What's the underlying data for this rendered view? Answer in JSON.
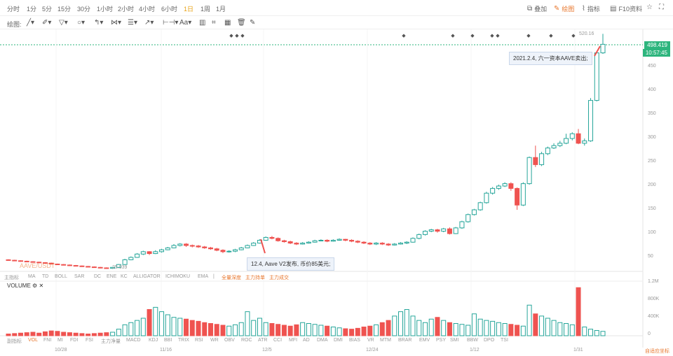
{
  "timeframes": [
    "分时",
    "1分",
    "5分",
    "15分",
    "30分",
    "1小时",
    "2小时",
    "4小时",
    "6小时",
    "1日",
    "1周",
    "1月"
  ],
  "active_timeframe": "1日",
  "top_right": {
    "overlay": "叠加",
    "draw": "绘图",
    "indicator": "指标",
    "f10": "F10资料"
  },
  "draw_label": "绘图:",
  "annotations": {
    "top": "2021.2.4, 六一资本AAVE卖出;",
    "bottom": "12.4, Aave V2发布, 币价85美元;"
  },
  "price_tags": {
    "peak": "520.16",
    "last": "498.419",
    "time": "10:57:45",
    "low": "25.939"
  },
  "watermark": "AAVE/USDT",
  "y_axis_labels": [
    "450",
    "400",
    "350",
    "300",
    "250",
    "200",
    "150",
    "100",
    "50"
  ],
  "main_indicators": [
    "主指标",
    "MA",
    "TD",
    "BOLL",
    "SAR",
    "DC",
    "ENE",
    "KC",
    "ALLIGATOR",
    "ICHIMOKU",
    "EMA",
    "|",
    "全量深度",
    "主力持单",
    "主力成交"
  ],
  "volume_label": "VOLUME",
  "volume_axis": [
    "1.2M",
    "800K",
    "400K",
    "0"
  ],
  "sub_indicators": [
    "副指标",
    "VOL",
    "FNI",
    "MI",
    "FDI",
    "FSI",
    "主力净量",
    "MACD",
    "KDJ",
    "BBI",
    "TRIX",
    "RSI",
    "WR",
    "OBV",
    "ROC",
    "ATR",
    "CCI",
    "MFI",
    "AD",
    "DMA",
    "DMI",
    "BIAS",
    "VR",
    "MTM",
    "BRAR",
    "EMV",
    "PSY",
    "SMI",
    "BBW",
    "DPO",
    "TSI"
  ],
  "x_axis_labels": [
    "10/28",
    "11/16",
    "12/5",
    "12/24",
    "1/12",
    "1/31"
  ],
  "corner_label": "自适应坐标",
  "colors": {
    "up": "#26a69a",
    "down": "#ef5350",
    "accent": "#e8772e",
    "active": "#e8a317",
    "last_price": "#2db57d"
  },
  "chart_data": {
    "type": "candlestick",
    "x_range": [
      "2020-10-20",
      "2021-02-05"
    ],
    "y_range": [
      25,
      520
    ],
    "candles": [
      [
        45,
        44,
        46,
        43
      ],
      [
        44,
        43,
        45,
        42
      ],
      [
        43,
        42,
        44,
        41
      ],
      [
        42,
        41,
        43,
        40
      ],
      [
        41,
        40,
        42,
        39
      ],
      [
        40,
        39,
        41,
        38
      ],
      [
        39,
        38,
        40,
        37
      ],
      [
        38,
        36,
        39,
        35
      ],
      [
        36,
        35,
        37,
        34
      ],
      [
        35,
        34,
        36,
        33
      ],
      [
        34,
        33,
        35,
        32
      ],
      [
        33,
        32,
        34,
        31
      ],
      [
        32,
        31,
        33,
        30
      ],
      [
        31,
        30,
        32,
        29
      ],
      [
        30,
        29,
        31,
        28
      ],
      [
        29,
        28,
        30,
        27
      ],
      [
        28,
        27,
        29,
        26
      ],
      [
        27,
        29,
        30,
        26
      ],
      [
        29,
        35,
        36,
        28
      ],
      [
        35,
        45,
        47,
        34
      ],
      [
        45,
        50,
        52,
        44
      ],
      [
        50,
        57,
        59,
        49
      ],
      [
        57,
        62,
        64,
        55
      ],
      [
        62,
        58,
        63,
        55
      ],
      [
        58,
        62,
        65,
        57
      ],
      [
        62,
        66,
        68,
        60
      ],
      [
        66,
        70,
        72,
        65
      ],
      [
        70,
        75,
        78,
        69
      ],
      [
        75,
        78,
        80,
        73
      ],
      [
        78,
        75,
        80,
        72
      ],
      [
        75,
        74,
        77,
        71
      ],
      [
        74,
        72,
        76,
        70
      ],
      [
        72,
        70,
        74,
        68
      ],
      [
        70,
        68,
        72,
        66
      ],
      [
        68,
        65,
        70,
        63
      ],
      [
        65,
        62,
        67,
        59
      ],
      [
        62,
        63,
        65,
        60
      ],
      [
        63,
        66,
        68,
        61
      ],
      [
        66,
        70,
        72,
        65
      ],
      [
        70,
        75,
        77,
        69
      ],
      [
        75,
        80,
        82,
        74
      ],
      [
        80,
        86,
        88,
        79
      ],
      [
        86,
        92,
        94,
        85
      ],
      [
        92,
        90,
        95,
        88
      ],
      [
        90,
        85,
        92,
        83
      ],
      [
        85,
        83,
        87,
        81
      ],
      [
        83,
        80,
        85,
        78
      ],
      [
        80,
        78,
        82,
        76
      ],
      [
        78,
        80,
        82,
        77
      ],
      [
        80,
        82,
        84,
        79
      ],
      [
        82,
        85,
        87,
        81
      ],
      [
        85,
        86,
        88,
        84
      ],
      [
        86,
        84,
        88,
        82
      ],
      [
        84,
        86,
        88,
        83
      ],
      [
        86,
        88,
        90,
        85
      ],
      [
        88,
        86,
        89,
        84
      ],
      [
        86,
        84,
        88,
        82
      ],
      [
        84,
        82,
        86,
        80
      ],
      [
        82,
        80,
        84,
        78
      ],
      [
        80,
        78,
        82,
        76
      ],
      [
        78,
        80,
        82,
        76
      ],
      [
        80,
        78,
        82,
        76
      ],
      [
        78,
        76,
        80,
        74
      ],
      [
        76,
        78,
        80,
        75
      ],
      [
        78,
        80,
        82,
        77
      ],
      [
        80,
        82,
        84,
        78
      ],
      [
        82,
        90,
        92,
        81
      ],
      [
        90,
        98,
        100,
        88
      ],
      [
        98,
        105,
        107,
        96
      ],
      [
        105,
        108,
        110,
        103
      ],
      [
        108,
        105,
        110,
        102
      ],
      [
        105,
        110,
        112,
        103
      ],
      [
        110,
        100,
        113,
        98
      ],
      [
        100,
        112,
        114,
        99
      ],
      [
        112,
        125,
        127,
        110
      ],
      [
        125,
        140,
        142,
        123
      ],
      [
        140,
        150,
        152,
        138
      ],
      [
        150,
        165,
        167,
        148
      ],
      [
        165,
        185,
        188,
        163
      ],
      [
        185,
        195,
        198,
        182
      ],
      [
        195,
        200,
        203,
        192
      ],
      [
        200,
        205,
        208,
        198
      ],
      [
        205,
        195,
        208,
        190
      ],
      [
        195,
        160,
        197,
        150
      ],
      [
        160,
        205,
        208,
        158
      ],
      [
        205,
        260,
        262,
        203
      ],
      [
        260,
        245,
        285,
        240
      ],
      [
        245,
        268,
        272,
        242
      ],
      [
        268,
        280,
        283,
        265
      ],
      [
        280,
        285,
        290,
        278
      ],
      [
        285,
        290,
        295,
        282
      ],
      [
        290,
        300,
        310,
        288
      ],
      [
        300,
        310,
        313,
        296
      ],
      [
        310,
        290,
        320,
        288
      ],
      [
        290,
        295,
        300,
        285
      ],
      [
        295,
        380,
        385,
        293
      ],
      [
        380,
        480,
        483,
        378
      ],
      [
        480,
        498,
        520,
        478
      ]
    ],
    "volume": [
      40,
      50,
      60,
      70,
      80,
      60,
      90,
      110,
      100,
      80,
      70,
      60,
      50,
      40,
      50,
      60,
      70,
      80,
      150,
      250,
      300,
      350,
      400,
      600,
      650,
      550,
      480,
      420,
      400,
      380,
      350,
      330,
      300,
      280,
      260,
      240,
      220,
      250,
      300,
      550,
      350,
      400,
      300,
      280,
      260,
      240,
      220,
      250,
      300,
      280,
      260,
      240,
      220,
      200,
      180,
      160,
      150,
      170,
      200,
      220,
      250,
      300,
      350,
      450,
      550,
      600,
      450,
      350,
      300,
      380,
      420,
      350,
      300,
      280,
      260,
      240,
      500,
      380,
      350,
      330,
      300,
      280,
      260,
      240,
      220,
      700,
      500,
      450,
      400,
      350,
      300,
      280,
      250,
      1100,
      200,
      150,
      120,
      100
    ]
  }
}
